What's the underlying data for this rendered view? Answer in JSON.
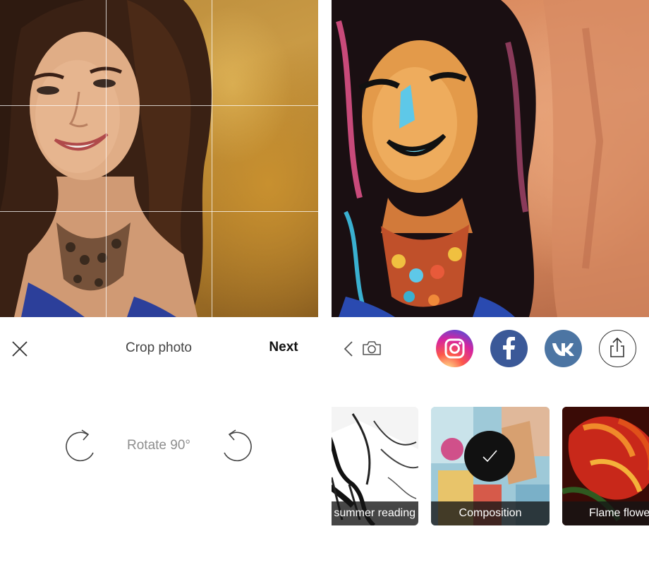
{
  "crop_screen": {
    "title": "Crop photo",
    "next_label": "Next",
    "rotate_label": "Rotate 90°",
    "icons": {
      "close": "close-icon",
      "rotate_left": "rotate-left-icon",
      "rotate_right": "rotate-right-icon"
    }
  },
  "result_screen": {
    "icons": {
      "back": "chevron-left-icon",
      "camera": "camera-icon"
    },
    "share_targets": [
      {
        "icon": "instagram-icon",
        "color": "#d6249f"
      },
      {
        "icon": "facebook-icon",
        "color": "#3b5998"
      },
      {
        "icon": "vk-icon",
        "color": "#4c75a3"
      },
      {
        "icon": "share-icon",
        "color": "#333333"
      }
    ],
    "styles": [
      {
        "label": "summer reading",
        "selected": false
      },
      {
        "label": "Composition",
        "selected": true
      },
      {
        "label": "Flame flower",
        "selected": false
      }
    ]
  }
}
